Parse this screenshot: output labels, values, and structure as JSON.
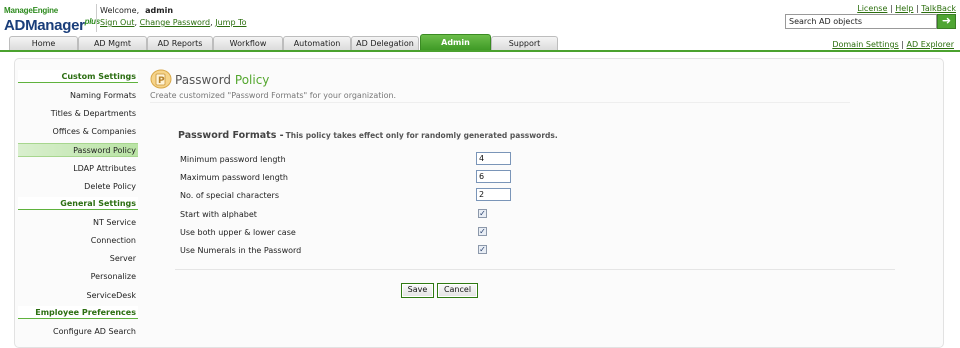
{
  "app": {
    "logo_top": "ManageEngine",
    "logo_name": "ADManager",
    "logo_plus": "plus"
  },
  "user": {
    "welcome_label": "Welcome,",
    "username": "admin",
    "sign_out": "Sign Out",
    "change_password": "Change Password",
    "jump_to": "Jump To"
  },
  "top_links": {
    "license": "License",
    "help": "Help",
    "talkback": "TalkBack"
  },
  "search": {
    "value": "Search AD objects",
    "go_glyph": "➜"
  },
  "tabs": [
    {
      "label": "Home"
    },
    {
      "label": "AD Mgmt"
    },
    {
      "label": "AD Reports"
    },
    {
      "label": "Workflow"
    },
    {
      "label": "Automation"
    },
    {
      "label": "AD Delegation"
    },
    {
      "label": "Admin"
    },
    {
      "label": "Support"
    }
  ],
  "tab_right": {
    "domain_settings": "Domain Settings",
    "ad_explorer": "AD Explorer"
  },
  "sidebar": {
    "items": [
      {
        "label": "Custom Settings"
      },
      {
        "label": "Naming Formats"
      },
      {
        "label": "Titles & Departments"
      },
      {
        "label": "Offices & Companies"
      },
      {
        "label": "Password Policy"
      },
      {
        "label": "LDAP Attributes"
      },
      {
        "label": "Delete Policy"
      },
      {
        "label": "General Settings"
      },
      {
        "label": "NT Service"
      },
      {
        "label": "Connection"
      },
      {
        "label": "Server"
      },
      {
        "label": "Personalize"
      },
      {
        "label": "ServiceDesk"
      },
      {
        "label": "Employee Preferences"
      },
      {
        "label": "Configure AD Search"
      }
    ]
  },
  "page": {
    "title_1": "Password",
    "title_2": "Policy",
    "subtitle": "Create customized \"Password Formats\" for your organization.",
    "section_title": "Password Formats -",
    "section_note": "This policy takes effect only for randomly generated passwords."
  },
  "form": {
    "min_length_label": "Minimum password length",
    "min_length_value": "4",
    "max_length_label": "Maximum password length",
    "max_length_value": "6",
    "special_chars_label": "No. of special characters",
    "special_chars_value": "2",
    "start_alpha_label": "Start with alphabet",
    "upper_lower_label": "Use both upper & lower case",
    "numerals_label": "Use Numerals in the Password",
    "check_glyph": "✓"
  },
  "buttons": {
    "save": "Save",
    "cancel": "Cancel"
  },
  "colors": {
    "brand_green": "#4ba22f",
    "link_green": "#2b6e0d",
    "logo_blue": "#1a3e7a"
  }
}
